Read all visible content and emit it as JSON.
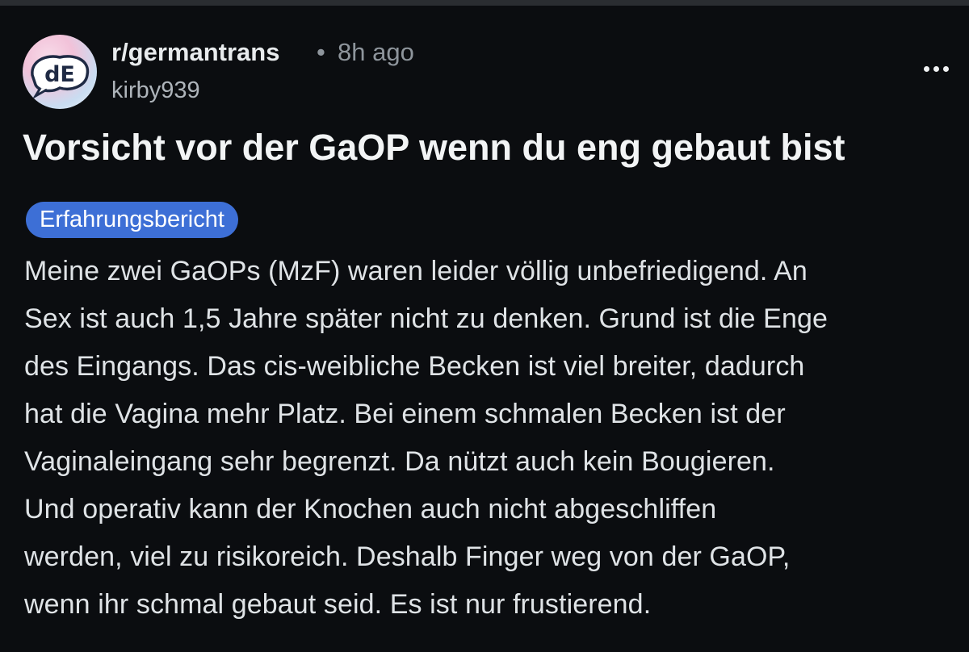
{
  "header": {
    "subreddit": "r/germantrans",
    "separator": "•",
    "time": "8h ago",
    "username": "kirby939",
    "avatar_icon": "subreddit-avatar-icon",
    "more_icon": "more-options-icon"
  },
  "post": {
    "title": "Vorsicht vor der GaOP wenn du eng gebaut bist",
    "flair": "Erfahrungsbericht",
    "body_lines": [
      "Meine zwei GaOPs (MzF) waren leider völlig unbefriedigend. An",
      "Sex ist auch 1,5 Jahre später nicht zu denken. Grund ist die Enge",
      "des Eingangs. Das cis-weibliche Becken ist viel breiter, dadurch",
      "hat die Vagina mehr Platz. Bei einem schmalen Becken ist der",
      "Vaginaleingang sehr begrenzt. Da nützt auch kein Bougieren.",
      "Und operativ kann der Knochen auch nicht abgeschliffen",
      "werden, viel zu risikoreich. Deshalb Finger weg von der GaOP,",
      "wenn ihr schmal gebaut seid. Es ist nur frustierend."
    ]
  },
  "colors": {
    "background": "#0b0d10",
    "flair": "#3d6fd6",
    "text": "#dfe3e6",
    "muted": "#8e959c"
  }
}
